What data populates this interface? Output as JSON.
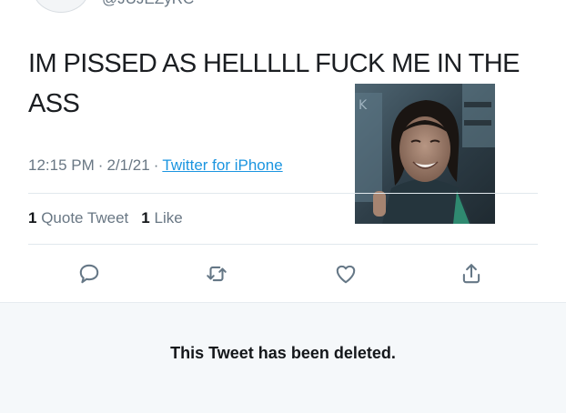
{
  "header": {
    "handle_cut": "@JUJEZyRC"
  },
  "tweet": {
    "text": "IM PISSED AS HELLLLL FUCK ME IN THE ASS",
    "time": "12:15 PM",
    "date": "2/1/21",
    "source": "Twitter for iPhone",
    "separator": "·"
  },
  "stats": {
    "quote_count": "1",
    "quote_label": "Quote Tweet",
    "like_count": "1",
    "like_label": "Like"
  },
  "actions": [
    {
      "name": "reply",
      "icon": "reply-icon"
    },
    {
      "name": "retweet",
      "icon": "retweet-icon"
    },
    {
      "name": "like",
      "icon": "heart-icon"
    },
    {
      "name": "share",
      "icon": "share-icon"
    }
  ],
  "deleted_notice": {
    "text": "This Tweet has been deleted."
  },
  "colors": {
    "text": "#14171a",
    "secondary": "#697784",
    "link": "#1b95e0",
    "divider": "#e1e8ed",
    "panel": "#f5f8fa"
  }
}
